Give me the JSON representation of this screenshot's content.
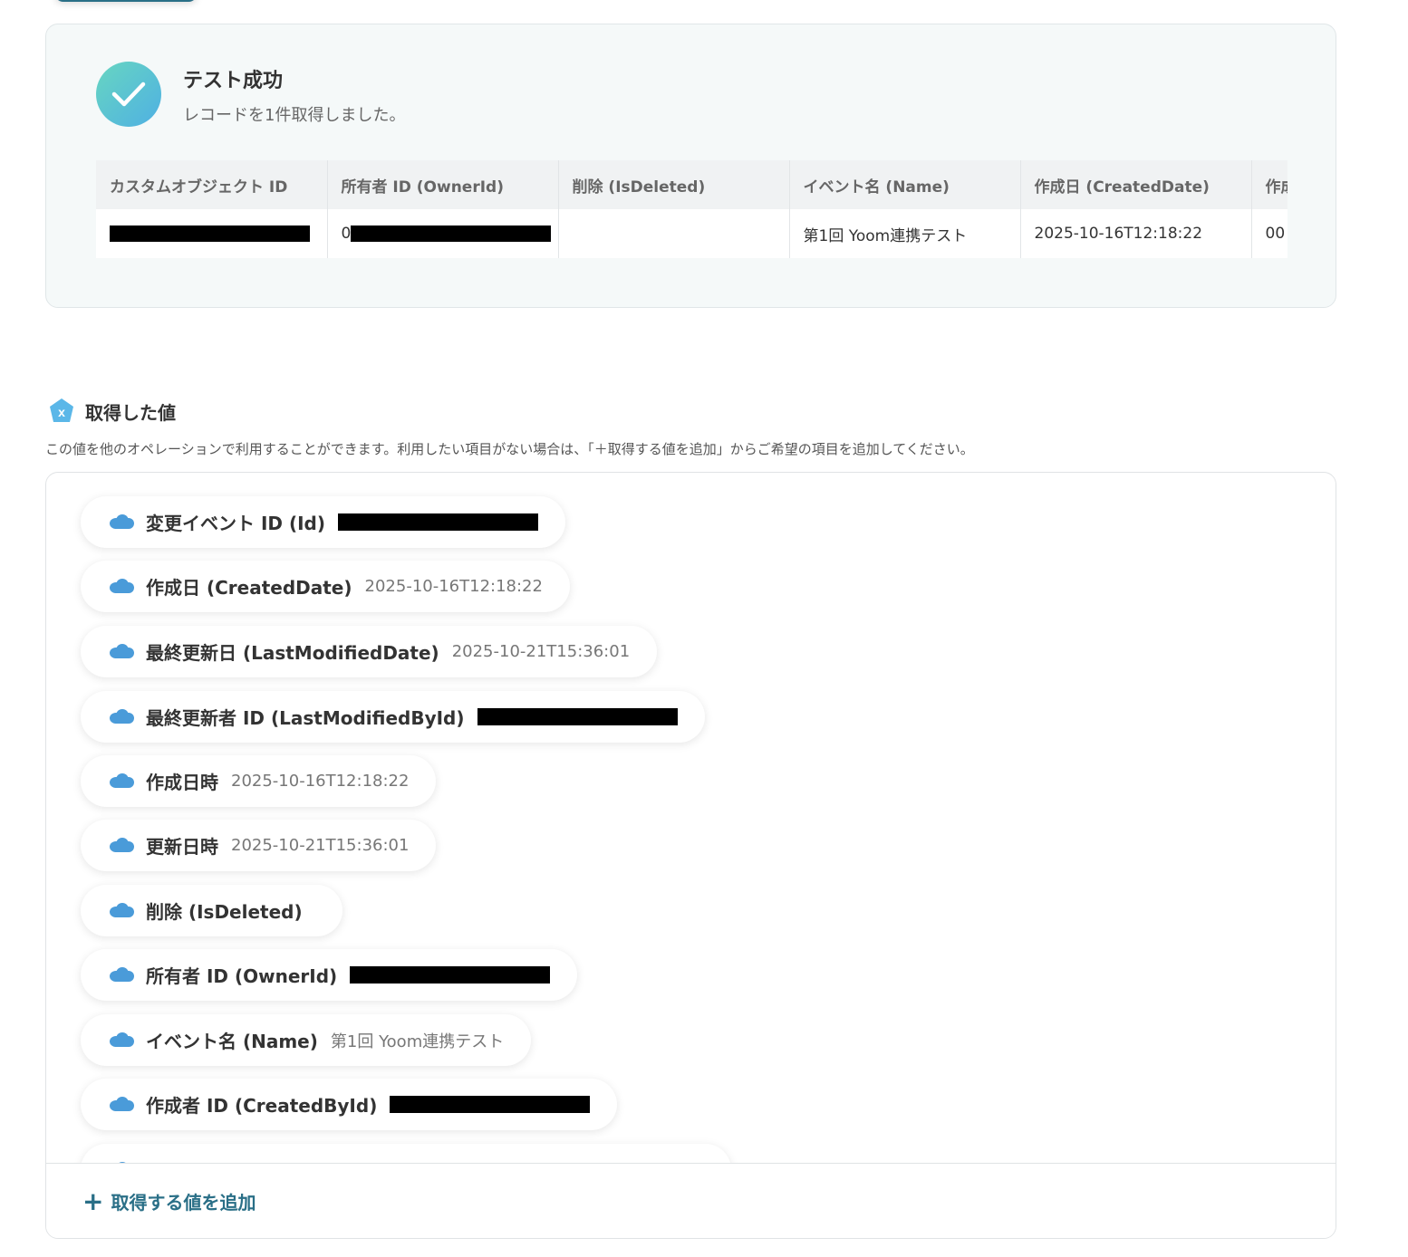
{
  "success": {
    "title": "テスト成功",
    "subtitle": "レコードを1件取得しました。",
    "accent": "#4fb0e3"
  },
  "table": {
    "headers": [
      "カスタムオブジェクト ID",
      "所有者 ID (OwnerId)",
      "削除 (IsDeleted)",
      "イベント名 (Name)",
      "作成日 (CreatedDate)",
      "作成"
    ],
    "row": [
      "",
      "0",
      "",
      "第1回 Yoom連携テスト",
      "2025-10-16T12:18:22",
      "00"
    ]
  },
  "section": {
    "title": "取得した値",
    "description": "この値を他のオペレーションで利用することができます。利用したい項目がない場合は、「＋取得する値を追加」からご希望の項目を追加してください。"
  },
  "values": [
    {
      "label": "変更イベント ID (Id)",
      "value": "",
      "redacted": true
    },
    {
      "label": "作成日 (CreatedDate)",
      "value": "2025-10-16T12:18:22",
      "redacted": false
    },
    {
      "label": "最終更新日 (LastModifiedDate)",
      "value": "2025-10-21T15:36:01",
      "redacted": false
    },
    {
      "label": "最終更新者 ID (LastModifiedById)",
      "value": "",
      "redacted": true
    },
    {
      "label": "作成日時",
      "value": "2025-10-16T12:18:22",
      "redacted": false
    },
    {
      "label": "更新日時",
      "value": "2025-10-21T15:36:01",
      "redacted": false
    },
    {
      "label": "削除 (IsDeleted)",
      "value": "",
      "redacted": false
    },
    {
      "label": "所有者 ID (OwnerId)",
      "value": "",
      "redacted": true
    },
    {
      "label": "イベント名 (Name)",
      "value": "第1回 Yoom連携テスト",
      "redacted": false
    },
    {
      "label": "作成者 ID (CreatedById)",
      "value": "",
      "redacted": true
    }
  ],
  "footer": {
    "add_label": "取得する値を追加",
    "accent": "#2a6f87"
  },
  "icons": {
    "check": "check-icon",
    "variable": "variable-icon",
    "cloud": "salesforce-cloud-icon",
    "plus": "plus-icon"
  }
}
